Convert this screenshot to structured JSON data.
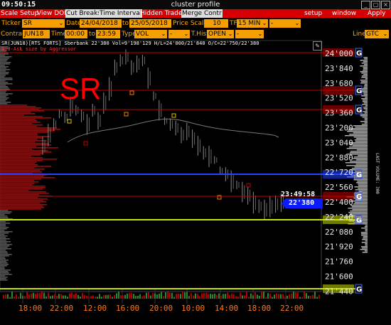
{
  "window": {
    "clock": "09:50:15",
    "title": "cluster profile"
  },
  "menu": {
    "left": [
      "Scale Setup",
      "View DOM",
      "Cut Breaks",
      "Time Interval",
      "Hidden Trades",
      "Merge Contr"
    ],
    "right": [
      "setup",
      "window",
      "Apply"
    ]
  },
  "toolbar1": {
    "ticker_label": "Ticker",
    "ticker": "SR",
    "date_label": "Date",
    "date_from": "24/04/2018",
    "to_label": "to",
    "date_to": "25/05/2018",
    "price_scale_label": "Price Scale",
    "price_scale": "10",
    "tf_label": "TF",
    "tf": "15 MIN",
    "tf_extra": "-"
  },
  "toolbar2": {
    "contract_label": "Contract",
    "contract": "JUN18",
    "time_label": "Time",
    "time_from": "00:00",
    "time_to": "23:59",
    "type_label": "Type",
    "type": "VOL",
    "type_extra": "-",
    "thist_label": "T.Hist",
    "thist": "OPEN",
    "thist_extra": "-",
    "line_label": "Line",
    "line": "GTC"
  },
  "chart": {
    "header": "SR(JUN18)[RTS FORTS] Sberbank   22'380  Vol=9'198'129  H/L=24'000/21'840  O/C=22'750/22'380",
    "subheader": "Bid-Ask size by Aggressor",
    "symbol_watermark": "SR",
    "countdown": "23:49:58",
    "last_price": "22'380",
    "volume_axis_label": "LAST VOLUME: 300",
    "price_ticks": [
      "24'000",
      "23'840",
      "23'680",
      "23'520",
      "23'360",
      "23'200",
      "23'040",
      "22'880",
      "22'720",
      "22'560",
      "22'400",
      "22'240",
      "22'080",
      "21'920",
      "21'760",
      "21'600",
      "21'440"
    ],
    "time_ticks": [
      "18:00",
      "22:00",
      "12:00",
      "16:00",
      "20:00",
      "10:00",
      "14:00",
      "18:00",
      "22:00"
    ],
    "level_markers": [
      "G",
      "G",
      "G",
      "G",
      "G",
      "G",
      "G"
    ],
    "colors": {
      "red_line": "#c00000",
      "blue_line": "#2244ff",
      "yellow_line": "#c8e000",
      "price_box": "#0a1cff",
      "accent": "#ff4000",
      "menu": "#d60000",
      "field": "#f5a000"
    }
  }
}
